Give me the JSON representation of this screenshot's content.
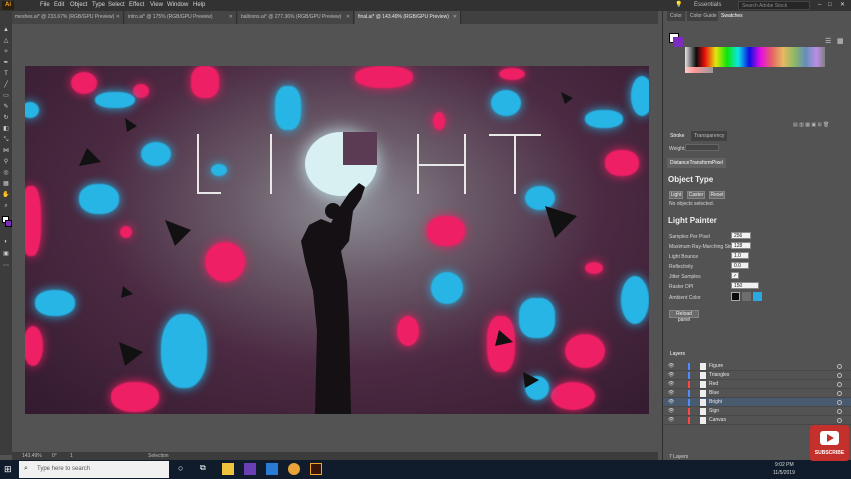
{
  "menubar": {
    "logo": "Ai",
    "items": [
      "File",
      "Edit",
      "Object",
      "Type",
      "Select",
      "Effect",
      "View",
      "Window",
      "Help"
    ],
    "workspace": "Essentials",
    "search_placeholder": "Search Adobe Stock"
  },
  "tabs": [
    {
      "label": "meshes.ai* @ 233.67% (RGB/GPU Preview)",
      "active": false
    },
    {
      "label": "intro.ai* @ 175% (RGB/GPU Preview)",
      "active": false
    },
    {
      "label": "balloons.ai* @ 277.36% (RGB/GPU Preview)",
      "active": false
    },
    {
      "label": "final.ai* @ 143.49% (RGB/GPU Preview)",
      "active": true
    }
  ],
  "artwork": {
    "title_letters": [
      "L",
      "I",
      "G",
      "H",
      "T"
    ]
  },
  "statusbar": {
    "zoom": "143.49%",
    "rotation": "0°",
    "artboard": "1",
    "tool": "Selection"
  },
  "right_panel": {
    "top_tabs": [
      "Color",
      "Color Guide",
      "Swatches"
    ],
    "stroke_tabs": [
      "Stroke",
      "Transparency"
    ],
    "weight_label": "Weight:",
    "distance_tab": "DistanceTransformPixel",
    "object_type_title": "Object Type",
    "object_type_buttons": [
      "Light",
      "Caster",
      "Reset"
    ],
    "no_selection": "No objects selected.",
    "light_painter_title": "Light Painter",
    "params": [
      {
        "label": "Samples Per Pixel",
        "value": "256"
      },
      {
        "label": "Maximum Ray-Marching Steps",
        "value": "128"
      },
      {
        "label": "Light Bounce",
        "value": "1.0"
      },
      {
        "label": "Reflectivity",
        "value": "0.0"
      },
      {
        "label": "Jitter Samples",
        "value": "✓"
      },
      {
        "label": "Raster DPI",
        "value": "150"
      },
      {
        "label": "Ambient Color",
        "value": ""
      }
    ],
    "ambient_colors": [
      "#0a0a0a",
      "#6e6e6e",
      "#2aa8e0"
    ],
    "reload_button": "Reload panel",
    "layers_tab": "Layers",
    "layers": [
      {
        "name": "Figure",
        "color": "#4f8cff"
      },
      {
        "name": "Triangles",
        "color": "#4f8cff"
      },
      {
        "name": "Red",
        "color": "#ff4646"
      },
      {
        "name": "Blue",
        "color": "#4f8cff"
      },
      {
        "name": "Bright",
        "color": "#4f8cff"
      },
      {
        "name": "Sign",
        "color": "#ff4646"
      },
      {
        "name": "Canvas",
        "color": "#ff4646"
      }
    ],
    "layers_count": "7 Layers"
  },
  "taskbar": {
    "search_placeholder": "Type here to search",
    "time": "9:02 PM",
    "date": "11/5/2019"
  },
  "subscribe_label": "SUBSCRIBE"
}
